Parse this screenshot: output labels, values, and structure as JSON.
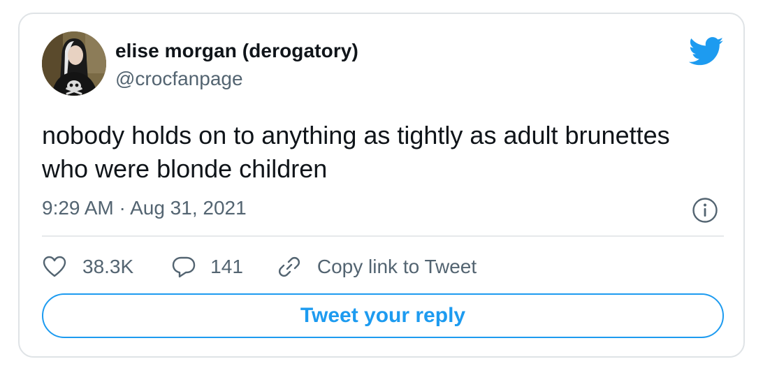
{
  "author": {
    "display_name": "elise morgan (derogatory)",
    "handle": "@crocfanpage",
    "avatar_icon": "profile-photo"
  },
  "tweet": {
    "text": "nobody holds on to anything as tightly as adult brunettes who were blonde children",
    "timestamp": "9:29 AM · Aug 31, 2021"
  },
  "actions": {
    "likes_count": "38.3K",
    "replies_count": "141",
    "copy_link_label": "Copy link to Tweet"
  },
  "reply_button_label": "Tweet your reply",
  "colors": {
    "brand_blue": "#1d9bf0",
    "text_primary": "#0f1419",
    "text_secondary": "#536471",
    "border": "#dfe3e6"
  },
  "icons": [
    "twitter-bird-icon",
    "info-icon",
    "heart-icon",
    "reply-bubble-icon",
    "link-icon"
  ]
}
